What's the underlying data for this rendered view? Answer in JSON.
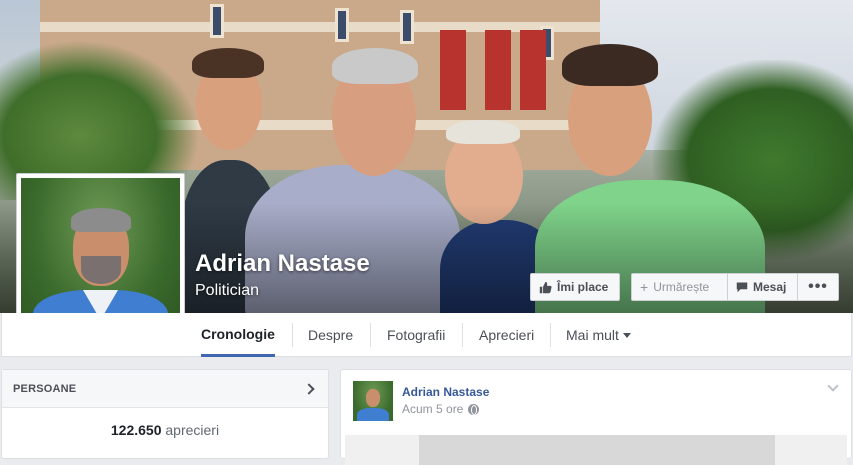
{
  "page": {
    "name": "Adrian Nastase",
    "category": "Politician"
  },
  "actions": {
    "like_label": "Îmi place",
    "follow_label": "Urmărește",
    "message_label": "Mesaj",
    "more_label": "•••"
  },
  "nav": {
    "tabs": [
      {
        "label": "Cronologie",
        "active": true
      },
      {
        "label": "Despre"
      },
      {
        "label": "Fotografii"
      },
      {
        "label": "Aprecieri"
      },
      {
        "label": "Mai mult"
      }
    ]
  },
  "sidebar": {
    "people_title": "PERSOANE",
    "likes_count": "122.650",
    "likes_label": "aprecieri"
  },
  "post": {
    "author": "Adrian Nastase",
    "time": "Acum 5 ore"
  },
  "colors": {
    "accent": "#4267b2",
    "link": "#365899"
  },
  "icons": {
    "like": "thumbs-up-icon",
    "follow": "plus-icon",
    "message": "chat-bubble-icon",
    "more": "ellipsis-icon",
    "people_arrow": "chevron-right-icon",
    "privacy": "globe-icon",
    "post_menu": "chevron-down-icon"
  }
}
